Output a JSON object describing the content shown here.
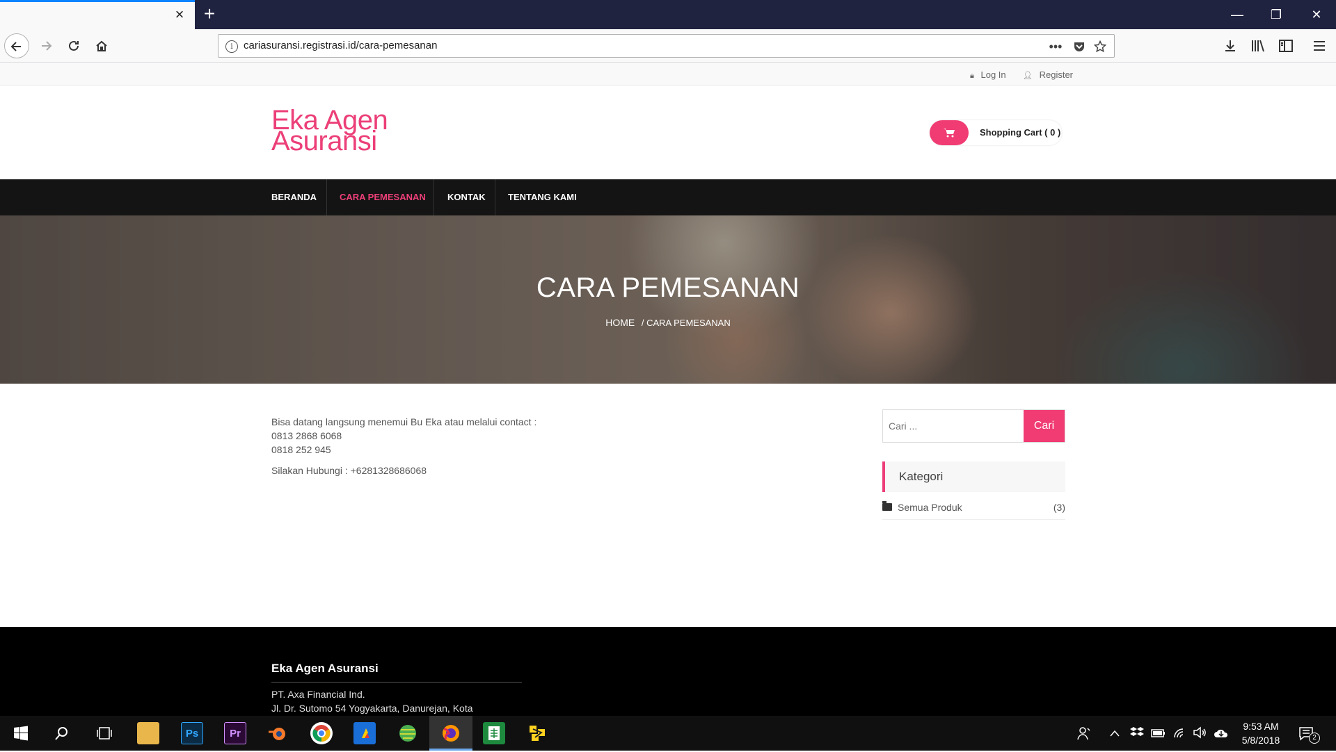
{
  "browser": {
    "tab_close": "×",
    "new_tab": "+",
    "url": "cariasuransi.registrasi.id/cara-pemesanan",
    "url_info": "i",
    "page_actions_more": "•••",
    "window": {
      "minimize": "—",
      "restore": "❐",
      "close": "✕"
    }
  },
  "topbar": {
    "login": "Log In",
    "register": "Register"
  },
  "header": {
    "logo_line1": "Eka Agen",
    "logo_line2": "Asuransi",
    "cart_label": "Shopping Cart ( 0 )"
  },
  "nav": {
    "items": [
      "BERANDA",
      "CARA PEMESANAN",
      "KONTAK",
      "TENTANG KAMI"
    ],
    "active_index": 1
  },
  "hero": {
    "title": "CARA PEMESANAN",
    "crumb_home": "HOME",
    "crumb_current": "/ CARA PEMESANAN"
  },
  "content": {
    "line1": "Bisa datang langsung menemui Bu Eka atau melalui contact :",
    "line2": "0813 2868 6068",
    "line3": "0818 252 945",
    "line4": "Silakan Hubungi : +6281328686068"
  },
  "sidebar": {
    "search_placeholder": "Cari ...",
    "search_button": "Cari",
    "category_heading": "Kategori",
    "categories": [
      {
        "label": "Semua Produk",
        "count": "(3)"
      }
    ]
  },
  "footer": {
    "title": "Eka Agen Asuransi",
    "line1": "PT. Axa Financial Ind.",
    "line2": "Jl. Dr. Sutomo 54 Yogyakarta, Danurejan, Kota"
  },
  "taskbar": {
    "apps": [
      "Ps",
      "Pr"
    ],
    "time": "9:53 AM",
    "date": "5/8/2018",
    "notifications": "2"
  },
  "colors": {
    "accent": "#ec3f78",
    "nav_bg": "#141414",
    "footer_bg": "#000000",
    "tabbar_bg": "#202340"
  }
}
